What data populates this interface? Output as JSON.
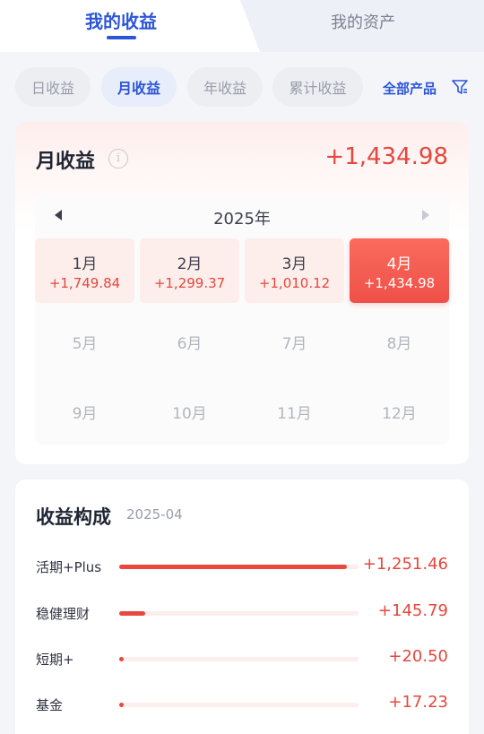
{
  "top_tabs": {
    "earnings": "我的收益",
    "assets": "我的资产"
  },
  "period_tabs": {
    "day": "日收益",
    "month": "月收益",
    "year": "年收益",
    "total": "累计收益",
    "active": "month"
  },
  "product_filter": {
    "label": "全部产品",
    "icon": "filter-icon"
  },
  "monthly": {
    "title": "月收益",
    "info_icon": "info-icon",
    "total": "+1,434.98",
    "year_label": "2025年",
    "prev_icon": "triangle-left-icon",
    "next_icon": "triangle-right-icon",
    "months": [
      {
        "name": "1月",
        "value": "+1,749.84"
      },
      {
        "name": "2月",
        "value": "+1,299.37"
      },
      {
        "name": "3月",
        "value": "+1,010.12"
      },
      {
        "name": "4月",
        "value": "+1,434.98",
        "selected": true
      },
      {
        "name": "5月",
        "value": ""
      },
      {
        "name": "6月",
        "value": ""
      },
      {
        "name": "7月",
        "value": ""
      },
      {
        "name": "8月",
        "value": ""
      },
      {
        "name": "9月",
        "value": ""
      },
      {
        "name": "10月",
        "value": ""
      },
      {
        "name": "11月",
        "value": ""
      },
      {
        "name": "12月",
        "value": ""
      }
    ]
  },
  "breakdown": {
    "title": "收益构成",
    "date": "2025-04",
    "items": [
      {
        "label": "活期+Plus",
        "value": "+1,251.46",
        "share": 0.95
      },
      {
        "label": "稳健理财",
        "value": "+145.79",
        "share": 0.11
      },
      {
        "label": "短期+",
        "value": "+20.50",
        "share": 0.02
      },
      {
        "label": "基金",
        "value": "+17.23",
        "share": 0.02
      }
    ]
  },
  "colors": {
    "accent_blue": "#2c55d8",
    "earnings_red": "#e4473d",
    "bar_red": "#e8483e"
  }
}
